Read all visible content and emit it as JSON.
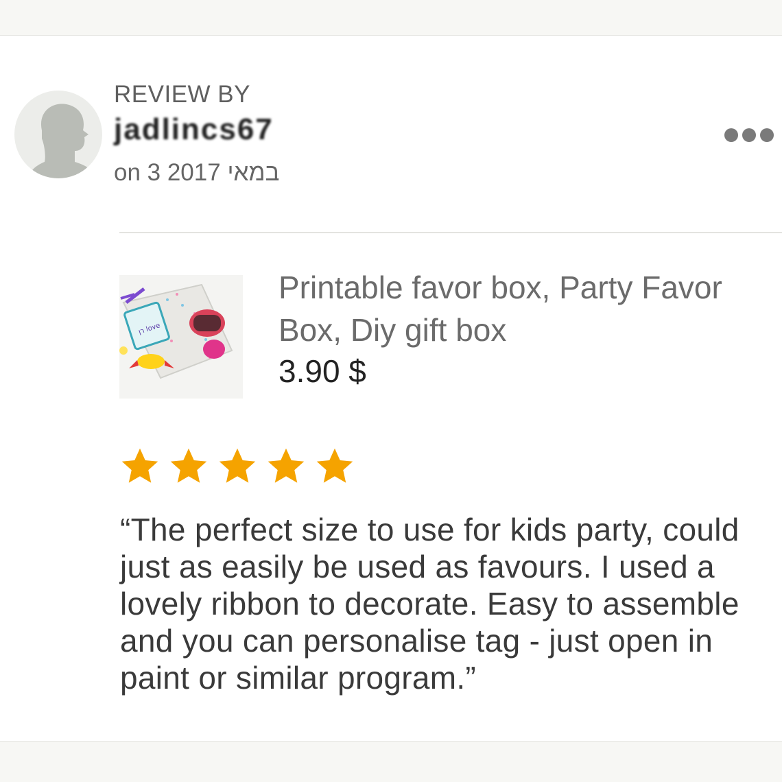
{
  "review": {
    "header_label": "REVIEW BY",
    "username": "jadlincs67",
    "date": "on 3 2017 במאי",
    "more_menu_icon": "ellipsis-icon",
    "avatar_icon": "default-user-avatar-icon"
  },
  "product": {
    "title": "Printable favor box, Party Favor Box, Diy gift box",
    "price": "3.90 $",
    "thumbnail_tag_text": "רן love"
  },
  "rating": {
    "stars": 5,
    "max": 5,
    "star_color": "#f5a300"
  },
  "review_text": "“The perfect size to use for kids party, could just as easily be used as favours. I used a lovely ribbon to decorate. Easy to assemble and you can personalise tag - just open in paint or similar program.”"
}
